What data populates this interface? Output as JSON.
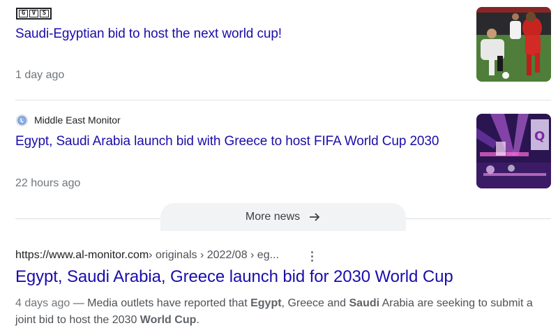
{
  "news": [
    {
      "source_logo_letters": [
        "G",
        "V",
        "S"
      ],
      "title": "Saudi-Egyptian bid to host the next world cup!",
      "time": "1 day ago",
      "thumbnail_icon": "football-match-photo"
    },
    {
      "source_name": "Middle East Monitor",
      "source_icon": "globe-icon",
      "title": "Egypt, Saudi Arabia launch bid with Greece to host FIFA World Cup 2030",
      "time": "22 hours ago",
      "thumbnail_icon": "stage-lights-photo"
    }
  ],
  "more_news": {
    "label": "More news",
    "icon": "arrow-right-icon"
  },
  "result": {
    "url_domain": "https://www.al-monitor.com",
    "url_breadcrumbs": " › originals › 2022/08 › eg...",
    "title": "Egypt, Saudi Arabia, Greece launch bid for 2030 World Cup",
    "snippet": {
      "date": "4 days ago",
      "dash": " — ",
      "parts": [
        {
          "text": "Media outlets have reported that ",
          "bold": false
        },
        {
          "text": "Egypt",
          "bold": true
        },
        {
          "text": ", Greece and ",
          "bold": false
        },
        {
          "text": "Saudi",
          "bold": true
        },
        {
          "text": " Arabia are seeking to submit a joint bid to host the 2030 ",
          "bold": false
        },
        {
          "text": "World Cup",
          "bold": true
        },
        {
          "text": ".",
          "bold": false
        }
      ]
    }
  },
  "colors": {
    "link": "#1a0dab",
    "meta": "#70757a",
    "text": "#202124"
  }
}
